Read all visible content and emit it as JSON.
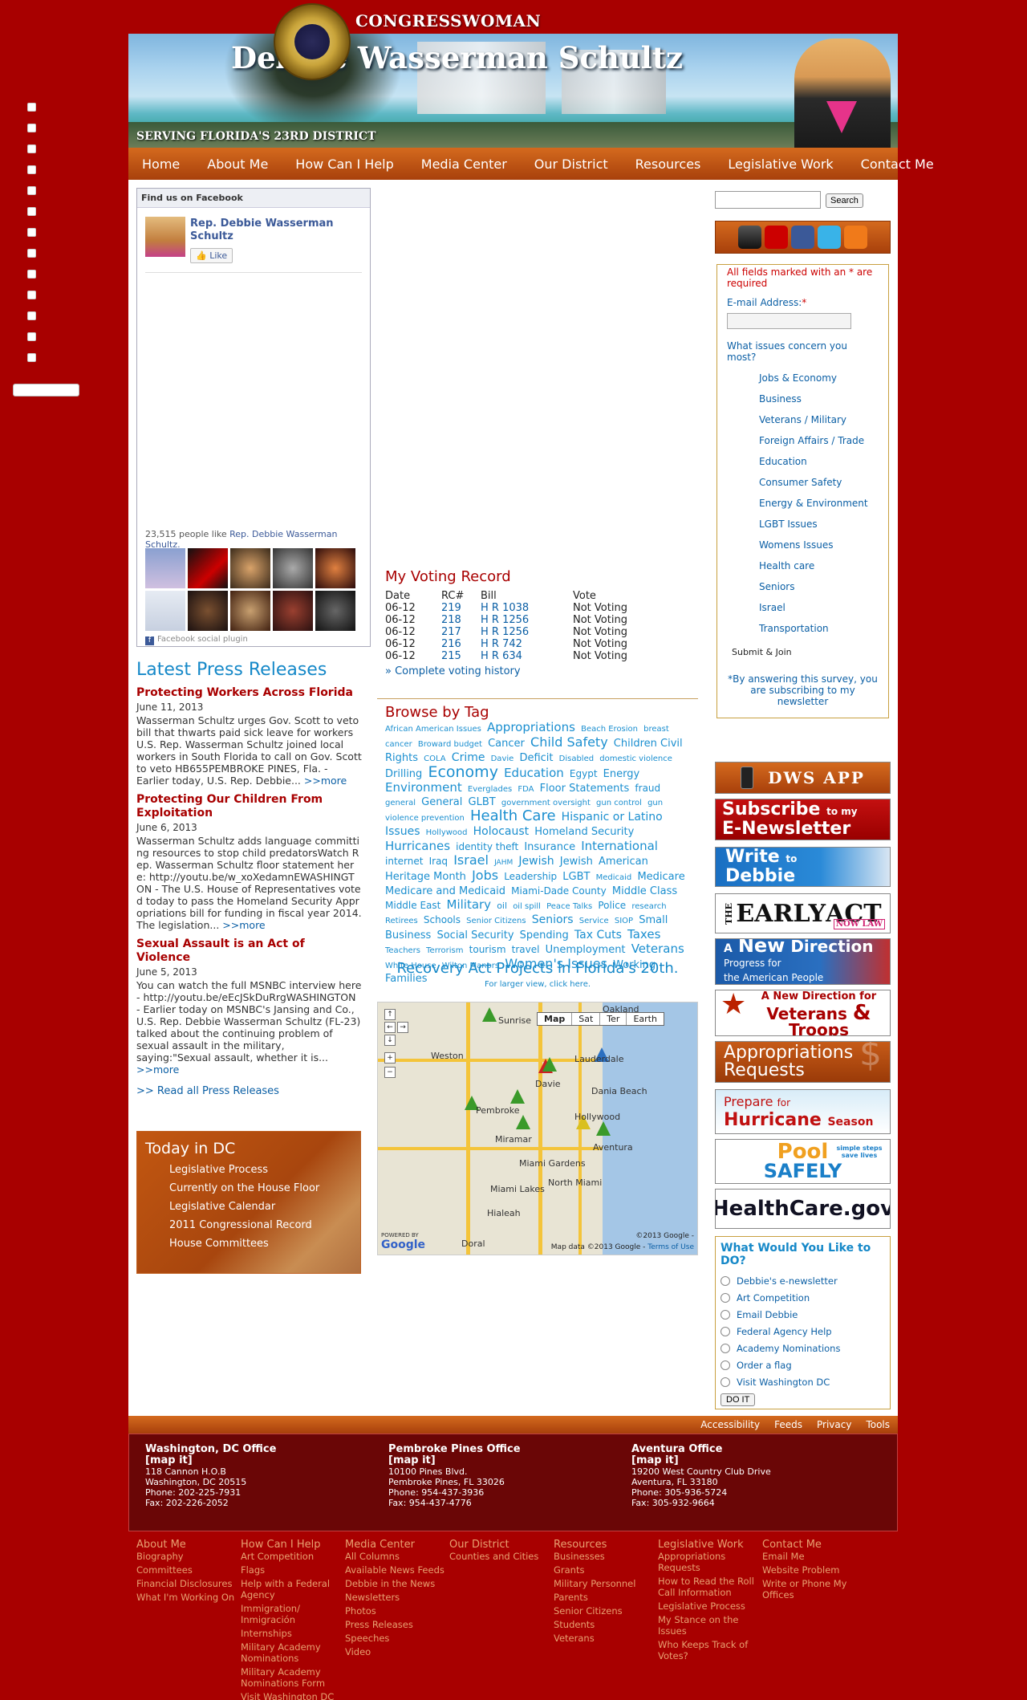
{
  "header": {
    "title_top": "CONGRESSWOMAN",
    "title_main": "Debbie Wasserman Schultz",
    "district": "SERVING FLORIDA'S 23RD DISTRICT"
  },
  "nav": [
    "Home",
    "About Me",
    "How Can I Help",
    "Media Center",
    "Our District",
    "Resources",
    "Legislative Work",
    "Contact Me"
  ],
  "facebook": {
    "header": "Find us on Facebook",
    "page_name": "Rep. Debbie Wasserman Schultz",
    "like": "Like",
    "count_text": "23,515 people like",
    "count_link": "Rep. Debbie Wasserman Schultz.",
    "plugin": "Facebook social plugin"
  },
  "press": {
    "heading": "Latest Press Releases",
    "items": [
      {
        "title": "Protecting Workers Across Florida",
        "date": "June 11, 2013",
        "text": "Wasserman Schultz urges Gov. Scott to veto bill that thwarts paid sick leave for workers U.S. Rep. Wasserman Schultz joined local workers in South Florida to call on Gov. Scott to veto HB655PEMBROKE PINES, Fla. - Earlier today, U.S. Rep. Debbie...",
        "more": ">>more"
      },
      {
        "title": "Protecting Our Children From Exploitation",
        "date": "June 6, 2013",
        "text": "Wasserman Schultz adds language committing resources to stop child predatorsWatch Rep. Wasserman Schultz floor statement here: http://youtu.be/w_xoXedamnEWASHINGTON - The U.S. House of Representatives voted today to pass the Homeland Security Appropriations bill for funding in fiscal year 2014. The legislation...",
        "more": ">>more"
      },
      {
        "title": "Sexual Assault is an Act of Violence",
        "date": "June 5, 2013",
        "text": "You can watch the full MSNBC interview here - http://youtu.be/eEcJSkDuRrgWASHINGTON - Earlier today on MSNBC's Jansing and Co., U.S. Rep. Debbie Wasserman Schultz (FL-23) talked about the continuing problem of sexual assault in the military, saying:\"Sexual assault, whether it is...",
        "more": ">>more"
      }
    ],
    "all": ">> Read all Press Releases"
  },
  "today": {
    "heading": "Today in DC",
    "links": [
      "Legislative Process",
      "Currently on the House Floor",
      "Legislative Calendar",
      "2011 Congressional Record",
      "House Committees"
    ]
  },
  "voting": {
    "heading": "My Voting Record",
    "columns": [
      "Date",
      "RC#",
      "Bill",
      "Vote"
    ],
    "rows": [
      [
        "06-12",
        "219",
        "H R 1038",
        "Not Voting"
      ],
      [
        "06-12",
        "218",
        "H R 1256",
        "Not Voting"
      ],
      [
        "06-12",
        "217",
        "H R 1256",
        "Not Voting"
      ],
      [
        "06-12",
        "216",
        "H R 742",
        "Not Voting"
      ],
      [
        "06-12",
        "215",
        "H R 634",
        "Not Voting"
      ]
    ],
    "history": "» Complete voting history"
  },
  "tags": {
    "heading": "Browse by Tag",
    "items": [
      {
        "t": "African American Issues",
        "s": 10
      },
      {
        "t": "Appropriations",
        "s": 15
      },
      {
        "t": "Beach Erosion",
        "s": 10
      },
      {
        "t": "breast cancer",
        "s": 10
      },
      {
        "t": "Broward budget",
        "s": 10
      },
      {
        "t": "Cancer",
        "s": 13
      },
      {
        "t": "Child Safety",
        "s": 16
      },
      {
        "t": "Children Civil Rights",
        "s": 13
      },
      {
        "t": "COLA",
        "s": 10
      },
      {
        "t": "Crime",
        "s": 14
      },
      {
        "t": "Davie",
        "s": 10
      },
      {
        "t": "Deficit",
        "s": 13
      },
      {
        "t": "Disabled",
        "s": 10
      },
      {
        "t": "domestic violence",
        "s": 10
      },
      {
        "t": "Drilling",
        "s": 13
      },
      {
        "t": "Economy",
        "s": 19
      },
      {
        "t": "Education",
        "s": 15
      },
      {
        "t": "Egypt",
        "s": 12
      },
      {
        "t": "Energy",
        "s": 13
      },
      {
        "t": "Environment",
        "s": 15
      },
      {
        "t": "Everglades",
        "s": 10
      },
      {
        "t": "FDA",
        "s": 10
      },
      {
        "t": "Floor Statements",
        "s": 13
      },
      {
        "t": "fraud",
        "s": 12
      },
      {
        "t": "general",
        "s": 10
      },
      {
        "t": "General",
        "s": 13
      },
      {
        "t": "GLBT",
        "s": 13
      },
      {
        "t": "government oversight",
        "s": 10
      },
      {
        "t": "gun control",
        "s": 10
      },
      {
        "t": "gun violence prevention",
        "s": 10
      },
      {
        "t": "Health Care",
        "s": 18
      },
      {
        "t": "Hispanic or Latino Issues",
        "s": 14
      },
      {
        "t": "Hollywood",
        "s": 10
      },
      {
        "t": "Holocaust",
        "s": 14
      },
      {
        "t": "Homeland Security",
        "s": 13
      },
      {
        "t": "Hurricanes",
        "s": 15
      },
      {
        "t": "identity theft",
        "s": 12
      },
      {
        "t": "Insurance",
        "s": 13
      },
      {
        "t": "International",
        "s": 15
      },
      {
        "t": "internet",
        "s": 12
      },
      {
        "t": "Iraq",
        "s": 12
      },
      {
        "t": "Israel",
        "s": 16
      },
      {
        "t": "JAHM",
        "s": 9
      },
      {
        "t": "Jewish",
        "s": 14
      },
      {
        "t": "Jewish",
        "s": 13
      },
      {
        "t": "American Heritage Month",
        "s": 13
      },
      {
        "t": "Jobs",
        "s": 16
      },
      {
        "t": "Leadership",
        "s": 12
      },
      {
        "t": "LGBT",
        "s": 13
      },
      {
        "t": "Medicaid",
        "s": 10
      },
      {
        "t": "Medicare",
        "s": 13
      },
      {
        "t": "Medicare and Medicaid",
        "s": 13
      },
      {
        "t": "Miami-Dade County",
        "s": 12
      },
      {
        "t": "Middle Class",
        "s": 13
      },
      {
        "t": "Middle East",
        "s": 12
      },
      {
        "t": "Military",
        "s": 15
      },
      {
        "t": "oil",
        "s": 11
      },
      {
        "t": "oil spill",
        "s": 10
      },
      {
        "t": "Peace Talks",
        "s": 10
      },
      {
        "t": "Police",
        "s": 12
      },
      {
        "t": "research",
        "s": 10
      },
      {
        "t": "Retirees",
        "s": 10
      },
      {
        "t": "Schools",
        "s": 12
      },
      {
        "t": "Senior Citizens",
        "s": 10
      },
      {
        "t": "Seniors",
        "s": 14
      },
      {
        "t": "Service",
        "s": 10
      },
      {
        "t": "SIOP",
        "s": 10
      },
      {
        "t": "Small Business",
        "s": 13
      },
      {
        "t": "Social Security",
        "s": 13
      },
      {
        "t": "Spending",
        "s": 13
      },
      {
        "t": "Tax Cuts",
        "s": 14
      },
      {
        "t": "Taxes",
        "s": 15
      },
      {
        "t": "Teachers",
        "s": 10
      },
      {
        "t": "Terrorism",
        "s": 10
      },
      {
        "t": "tourism",
        "s": 12
      },
      {
        "t": "travel",
        "s": 12
      },
      {
        "t": "Unemployment",
        "s": 13
      },
      {
        "t": "Veterans",
        "s": 15
      },
      {
        "t": "White House",
        "s": 10
      },
      {
        "t": "Wilton Manors",
        "s": 10
      },
      {
        "t": "Women's Issues",
        "s": 16
      },
      {
        "t": "Working Families",
        "s": 13
      }
    ]
  },
  "recovery": {
    "heading": "Recovery Act Projects in Florida's 20th.",
    "sub": "For larger view, click here."
  },
  "map": {
    "types": [
      "Map",
      "Sat",
      "Ter",
      "Earth"
    ],
    "places": [
      "Oakland",
      "Sunrise",
      "Weston",
      "Lauderdale",
      "Davie",
      "Pembroke",
      "Hollywood",
      "Miramar",
      "Miami Gardens",
      "North Miami",
      "Hialeah",
      "Doral",
      "Dania Beach",
      "Aventura",
      "Miami Lakes"
    ],
    "copyright": "©2013 Google -",
    "data": "Map data ©2013 Google -",
    "terms": "Terms of Use",
    "powered": "POWERED BY",
    "google": "Google"
  },
  "search": {
    "button": "Search",
    "placeholder": ""
  },
  "survey": {
    "required": "All fields marked with an * are required",
    "email_label": "E-mail Address:",
    "email_star": "*",
    "question": "What issues concern you most?",
    "issues": [
      "Jobs & Economy",
      "Business",
      "Veterans / Military",
      "Foreign Affairs / Trade",
      "Education",
      "Consumer Safety",
      "Energy & Environment",
      "LGBT Issues",
      "Womens Issues",
      "Health care",
      "Seniors",
      "Israel",
      "Transportation"
    ],
    "submit": "Submit & Join",
    "note": "*By answering this survey, you are subscribing to my newsletter"
  },
  "banners": {
    "app": "DWS APP",
    "subscribe_1": "Subscribe",
    "subscribe_2": "to my",
    "subscribe_3": "E-Newsletter",
    "write_1": "Write",
    "write_2": "to",
    "write_3": "Debbie",
    "early_1": "THE",
    "early_2": "EARLY",
    "early_3": "ACT",
    "early_4": "NOW LAW",
    "newdir_1": "A",
    "newdir_2": "New",
    "newdir_3": "Direction",
    "newdir_4": "Progress for",
    "newdir_5": "the American People",
    "vets_1": "A New Direction for",
    "vets_2": "Veterans",
    "vets_3": "&",
    "vets_4": "Troops",
    "approp_1": "Appropriations",
    "approp_2": "Requests",
    "hurr_1": "Prepare",
    "hurr_2": "for",
    "hurr_3": "Hurricane",
    "hurr_4": "Season",
    "pool_1": "Pool",
    "pool_2": "SAFELY",
    "pool_3": "simple steps save lives",
    "hc": "HealthCare.gov"
  },
  "todo": {
    "heading": "What Would You Like to DO?",
    "options": [
      "Debbie's e-newsletter",
      "Art Competition",
      "Email Debbie",
      "Federal Agency Help",
      "Academy Nominations",
      "Order a flag",
      "Visit Washington DC"
    ],
    "button": "DO IT"
  },
  "util": [
    "Accessibility",
    "Feeds",
    "Privacy",
    "Tools"
  ],
  "offices": [
    {
      "name": "Washington, DC Office",
      "map": "[map it]",
      "lines": [
        "118 Cannon H.O.B",
        "Washington, DC 20515",
        "Phone: 202-225-7931",
        "Fax: 202-226-2052"
      ]
    },
    {
      "name": "Pembroke Pines Office",
      "map": "[map it]",
      "lines": [
        "10100 Pines Blvd.",
        "Pembroke Pines, FL 33026",
        "Phone: 954-437-3936",
        "Fax: 954-437-4776"
      ]
    },
    {
      "name": "Aventura Office",
      "map": "[map it]",
      "lines": [
        "19200 West Country Club Drive",
        "Aventura, FL 33180",
        "Phone: 305-936-5724",
        "Fax: 305-932-9664"
      ]
    }
  ],
  "footer": [
    {
      "head": "About Me",
      "links": [
        "Biography",
        "Committees",
        "Financial Disclosures",
        "What I'm Working On"
      ]
    },
    {
      "head": "How Can I Help",
      "links": [
        "Art Competition",
        "Flags",
        "Help with a Federal Agency",
        "Immigration/ Inmigración",
        "Internships",
        "Military Academy Nominations",
        "Military Academy Nominations Form",
        "Visit Washington DC"
      ]
    },
    {
      "head": "Media Center",
      "links": [
        "All Columns",
        "Available News Feeds",
        "Debbie in the News",
        "Newsletters",
        "Photos",
        "Press Releases",
        "Speeches",
        "Video"
      ]
    },
    {
      "head": "Our District",
      "links": [
        "Counties and Cities"
      ]
    },
    {
      "head": "Resources",
      "links": [
        "Businesses",
        "Grants",
        "Military Personnel",
        "Parents",
        "Senior Citizens",
        "Students",
        "Veterans"
      ]
    },
    {
      "head": "Legislative Work",
      "links": [
        "Appropriations Requests",
        "How to Read the Roll Call Information",
        "Legislative Process",
        "My Stance on the Issues",
        "Who Keeps Track of Votes?"
      ]
    },
    {
      "head": "Contact Me",
      "links": [
        "Email Me",
        "Website Problem",
        "Write or Phone My Offices"
      ]
    }
  ]
}
